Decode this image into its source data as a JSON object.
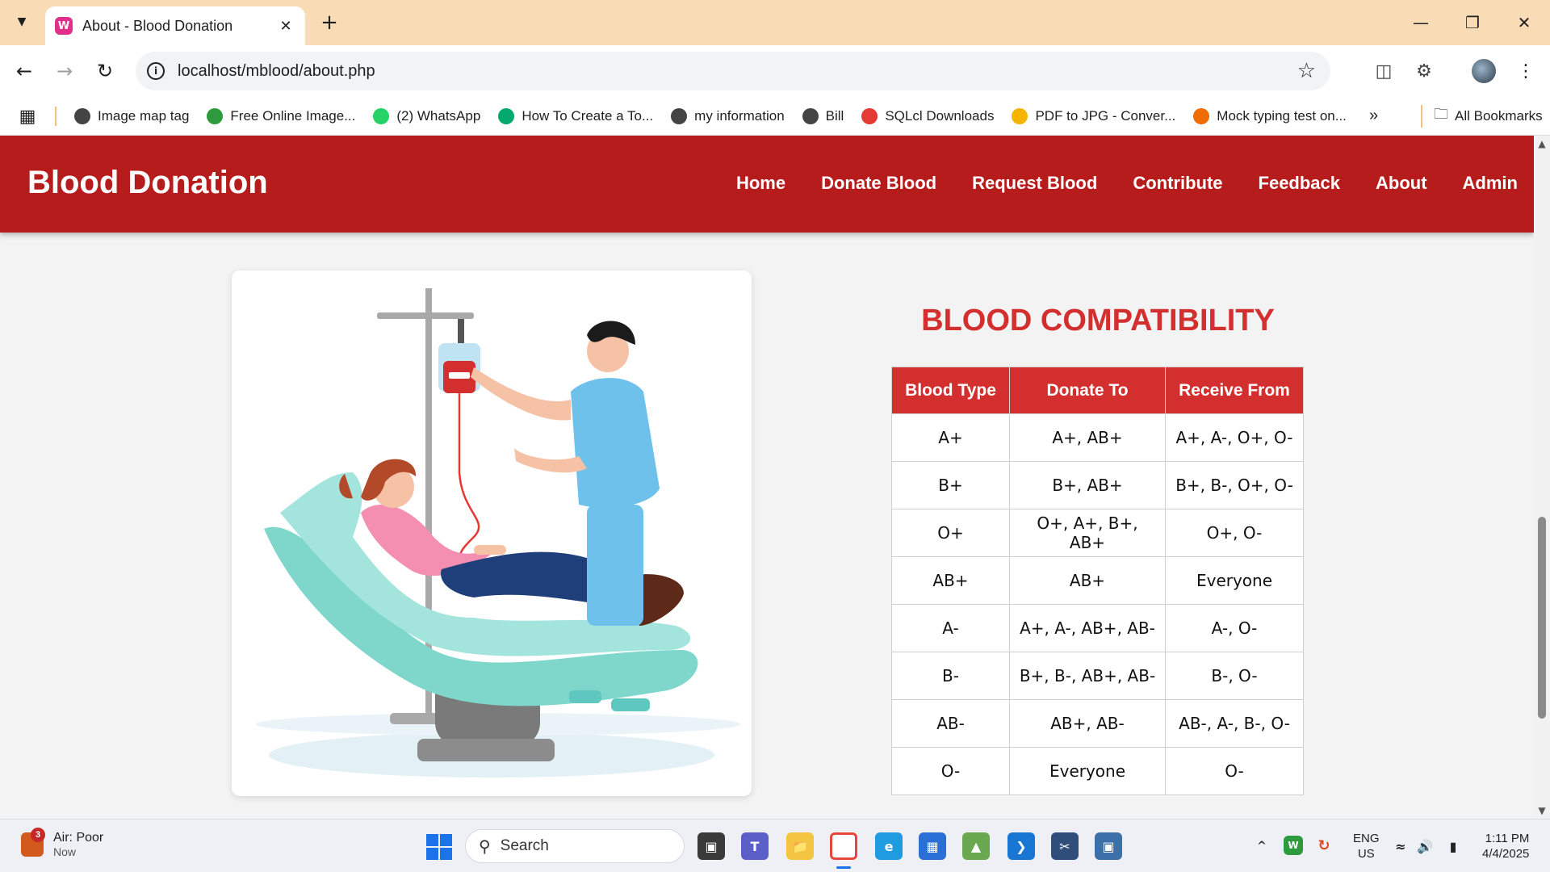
{
  "browser": {
    "tab_title": "About - Blood Donation",
    "url": "localhost/mblood/about.php",
    "bookmarks": [
      {
        "label": "Image map tag",
        "icon": "globe-icon",
        "color": "#444444"
      },
      {
        "label": "Free Online Image...",
        "icon": "image-icon",
        "color": "#2e9a3e"
      },
      {
        "label": "(2) WhatsApp",
        "icon": "whatsapp-icon",
        "color": "#25d366"
      },
      {
        "label": "How To Create a To...",
        "icon": "w3-icon",
        "color": "#04aa6d"
      },
      {
        "label": "my information",
        "icon": "globe-icon",
        "color": "#444444"
      },
      {
        "label": "Bill",
        "icon": "globe-icon",
        "color": "#444444"
      },
      {
        "label": "SQLcl Downloads",
        "icon": "oracle-icon",
        "color": "#e53935"
      },
      {
        "label": "PDF to JPG - Conver...",
        "icon": "pdf-icon",
        "color": "#f4b400"
      },
      {
        "label": "Mock typing test on...",
        "icon": "up-icon",
        "color": "#ef6c00"
      }
    ],
    "all_bookmarks": "All Bookmarks"
  },
  "site": {
    "brand": "Blood Donation",
    "nav": [
      "Home",
      "Donate Blood",
      "Request Blood",
      "Contribute",
      "Feedback",
      "About",
      "Admin"
    ],
    "colors": {
      "header": "#b71c1c",
      "accent": "#d32f2f"
    }
  },
  "compat": {
    "title": "BLOOD COMPATIBILITY",
    "headers": [
      "Blood Type",
      "Donate To",
      "Receive From"
    ],
    "rows": [
      [
        "A+",
        "A+, AB+",
        "A+, A-, O+, O-"
      ],
      [
        "B+",
        "B+, AB+",
        "B+, B-, O+, O-"
      ],
      [
        "O+",
        "O+, A+, B+, AB+",
        "O+, O-"
      ],
      [
        "AB+",
        "AB+",
        "Everyone"
      ],
      [
        "A-",
        "A+, A-, AB+, AB-",
        "A-, O-"
      ],
      [
        "B-",
        "B+, B-, AB+, AB-",
        "B-, O-"
      ],
      [
        "AB-",
        "AB+, AB-",
        "AB-, A-, B-, O-"
      ],
      [
        "O-",
        "Everyone",
        "O-"
      ]
    ]
  },
  "taskbar": {
    "weather_title": "Air: Poor",
    "weather_sub": "Now",
    "weather_badge": "3",
    "search_placeholder": "Search",
    "lang_line1": "ENG",
    "lang_line2": "US",
    "time": "1:11 PM",
    "date": "4/4/2025"
  }
}
